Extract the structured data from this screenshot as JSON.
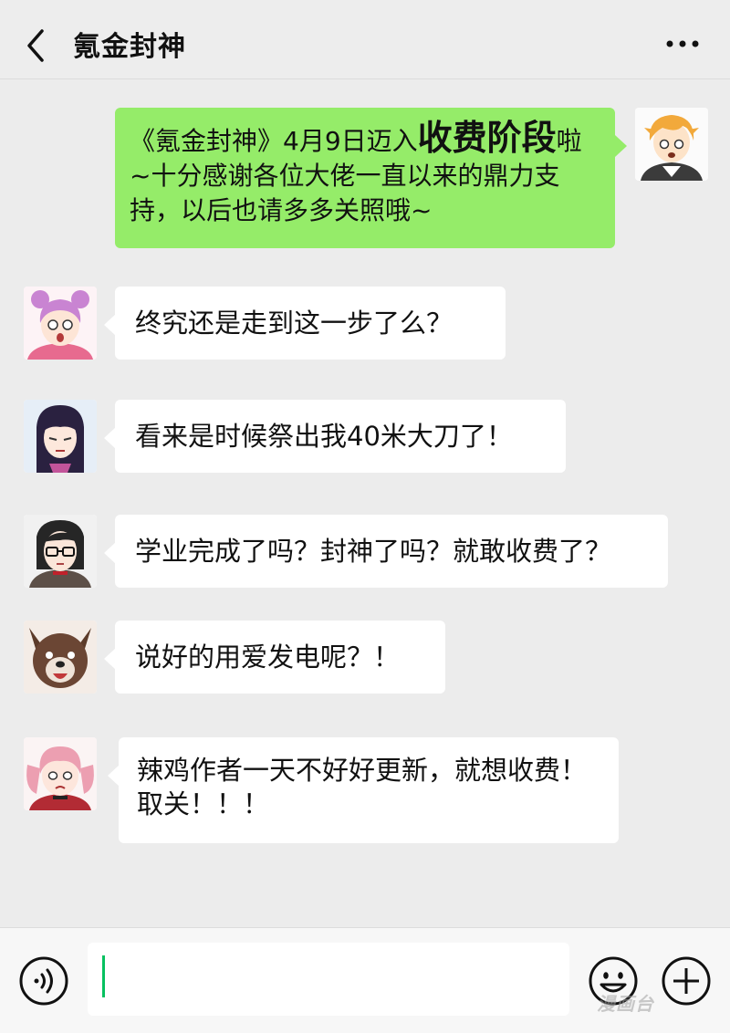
{
  "header": {
    "title": "氪金封神",
    "back_icon": "chevron-left-icon",
    "more_icon": "more-dots-icon"
  },
  "messages": [
    {
      "side": "right",
      "avatar": "blonde-boy-avatar",
      "text_part1": "《氪金封神》4月9日迈入",
      "text_highlight": "收费阶段",
      "text_part2": "啦~十分感谢各位大佬一直以来的鼎力支持，以后也请多多关照哦~"
    },
    {
      "side": "left",
      "avatar": "pink-hair-girl-avatar",
      "text": "终究还是走到这一步了么？"
    },
    {
      "side": "left",
      "avatar": "dark-hair-girl-avatar",
      "text": "看来是时候祭出我40米大刀了！"
    },
    {
      "side": "left",
      "avatar": "glasses-woman-avatar",
      "text": "学业完成了吗？封神了吗？就敢收费了？"
    },
    {
      "side": "left",
      "avatar": "dog-avatar",
      "text": "说好的用爱发电呢？！"
    },
    {
      "side": "left",
      "avatar": "pink-pigtails-girl-avatar",
      "text": "辣鸡作者一天不好好更新，就想收费！取关！！！"
    }
  ],
  "input_bar": {
    "value": "",
    "voice_icon": "voice-icon",
    "emoji_icon": "emoji-icon",
    "plus_icon": "plus-icon"
  },
  "watermark": "漫画台",
  "colors": {
    "self_bubble": "#95ec69",
    "other_bubble": "#ffffff",
    "background": "#ececec",
    "cursor": "#07c160"
  }
}
